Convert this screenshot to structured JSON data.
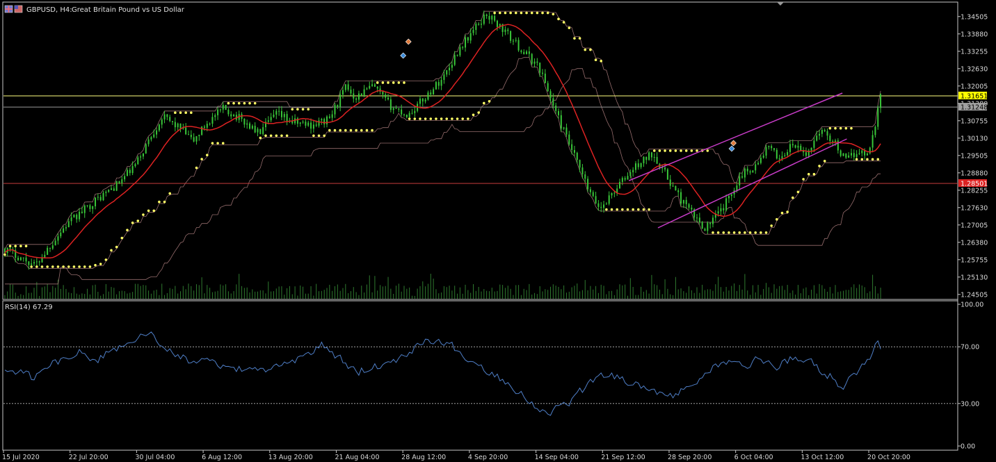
{
  "title": {
    "symbol_label": "GBPUSD, H4:",
    "description": "Great Britain Pound vs US Dollar"
  },
  "rsi": {
    "label": "RSI(14) 67.29",
    "levels": [
      70,
      30
    ],
    "ticks": [
      "100.00",
      "70.00",
      "30.00",
      "0.00"
    ]
  },
  "colors": {
    "background": "#000000",
    "candle": "#39c739",
    "parabolic_sar": "#ffff66",
    "moving_average": "#dd2222",
    "envelope": "#b08080",
    "channel": "#c83cc8",
    "volume": "#2f7a2f",
    "rsi_line": "#4f7fc8",
    "hline_current": "#ffff80",
    "hline_mid": "#9a9a9a",
    "hline_red": "#c83c3c",
    "current_price_box": "#ffff00",
    "mid_price_box": "#a0a0a0",
    "red_price_box": "#dd2222"
  },
  "chart_data": {
    "type": "line",
    "price_ticks": [
      "1.34505",
      "1.33880",
      "1.33255",
      "1.32630",
      "1.32005",
      "1.31380",
      "1.30755",
      "1.30130",
      "1.29505",
      "1.28880",
      "1.28255",
      "1.27630",
      "1.27005",
      "1.26380",
      "1.25755",
      "1.25130",
      "1.24505"
    ],
    "time_ticks": [
      "15 Jul 2020",
      "22 Jul 20:00",
      "30 Jul 04:00",
      "6 Aug 12:00",
      "13 Aug 20:00",
      "21 Aug 04:00",
      "28 Aug 12:00",
      "4 Sep 20:00",
      "14 Sep 04:00",
      "21 Sep 12:00",
      "28 Sep 20:00",
      "6 Oct 04:00",
      "13 Oct 12:00",
      "20 Oct 20:00"
    ],
    "ylim": [
      1.244,
      1.349
    ],
    "price_close_profile": [
      [
        0,
        1.2615
      ],
      [
        0.02,
        1.258
      ],
      [
        0.035,
        1.2555
      ],
      [
        0.05,
        1.262
      ],
      [
        0.07,
        1.27
      ],
      [
        0.1,
        1.278
      ],
      [
        0.13,
        1.285
      ],
      [
        0.15,
        1.292
      ],
      [
        0.165,
        1.301
      ],
      [
        0.18,
        1.309
      ],
      [
        0.2,
        1.305
      ],
      [
        0.215,
        1.3
      ],
      [
        0.23,
        1.3065
      ],
      [
        0.25,
        1.312
      ],
      [
        0.27,
        1.308
      ],
      [
        0.29,
        1.303
      ],
      [
        0.31,
        1.31
      ],
      [
        0.33,
        1.307
      ],
      [
        0.35,
        1.306
      ],
      [
        0.37,
        1.308
      ],
      [
        0.39,
        1.32
      ],
      [
        0.4,
        1.316
      ],
      [
        0.42,
        1.32
      ],
      [
        0.44,
        1.313
      ],
      [
        0.46,
        1.3095
      ],
      [
        0.48,
        1.316
      ],
      [
        0.5,
        1.323
      ],
      [
        0.52,
        1.334
      ],
      [
        0.55,
        1.346
      ],
      [
        0.57,
        1.34
      ],
      [
        0.59,
        1.333
      ],
      [
        0.61,
        1.327
      ],
      [
        0.63,
        1.31
      ],
      [
        0.65,
        1.295
      ],
      [
        0.67,
        1.28
      ],
      [
        0.68,
        1.276
      ],
      [
        0.7,
        1.284
      ],
      [
        0.72,
        1.291
      ],
      [
        0.74,
        1.296
      ],
      [
        0.755,
        1.288
      ],
      [
        0.77,
        1.28
      ],
      [
        0.79,
        1.272
      ],
      [
        0.8,
        1.269
      ],
      [
        0.82,
        1.276
      ],
      [
        0.84,
        1.288
      ],
      [
        0.86,
        1.292
      ],
      [
        0.87,
        1.298
      ],
      [
        0.885,
        1.294
      ],
      [
        0.9,
        1.299
      ],
      [
        0.915,
        1.295
      ],
      [
        0.93,
        1.304
      ],
      [
        0.945,
        1.301
      ],
      [
        0.96,
        1.293
      ],
      [
        0.975,
        1.297
      ],
      [
        0.985,
        1.295
      ],
      [
        0.995,
        1.308
      ],
      [
        1.0,
        1.3165
      ]
    ],
    "horizontal_lines": [
      {
        "price": 1.31651,
        "label": "1.31651"
      },
      {
        "price": 1.31248,
        "label": "1.31248"
      },
      {
        "price": 1.28501,
        "label": "1.28501"
      }
    ],
    "trend_channel": {
      "upper": [
        [
          0.712,
          1.286
        ],
        [
          0.955,
          1.3175
        ]
      ],
      "lower": [
        [
          0.745,
          1.269
        ],
        [
          0.96,
          1.301
        ]
      ]
    },
    "rsi_profile": [
      [
        0,
        55
      ],
      [
        0.03,
        48
      ],
      [
        0.06,
        60
      ],
      [
        0.08,
        68
      ],
      [
        0.1,
        60
      ],
      [
        0.13,
        70
      ],
      [
        0.15,
        75
      ],
      [
        0.165,
        80
      ],
      [
        0.18,
        70
      ],
      [
        0.2,
        62
      ],
      [
        0.23,
        58
      ],
      [
        0.26,
        55
      ],
      [
        0.28,
        52
      ],
      [
        0.31,
        56
      ],
      [
        0.34,
        62
      ],
      [
        0.36,
        72
      ],
      [
        0.38,
        62
      ],
      [
        0.4,
        52
      ],
      [
        0.42,
        56
      ],
      [
        0.45,
        62
      ],
      [
        0.47,
        72
      ],
      [
        0.49,
        76
      ],
      [
        0.51,
        70
      ],
      [
        0.53,
        60
      ],
      [
        0.56,
        50
      ],
      [
        0.58,
        42
      ],
      [
        0.6,
        30
      ],
      [
        0.62,
        24
      ],
      [
        0.64,
        30
      ],
      [
        0.66,
        40
      ],
      [
        0.68,
        52
      ],
      [
        0.7,
        48
      ],
      [
        0.72,
        44
      ],
      [
        0.74,
        40
      ],
      [
        0.76,
        34
      ],
      [
        0.78,
        42
      ],
      [
        0.8,
        52
      ],
      [
        0.82,
        60
      ],
      [
        0.84,
        56
      ],
      [
        0.86,
        62
      ],
      [
        0.88,
        56
      ],
      [
        0.9,
        62
      ],
      [
        0.92,
        58
      ],
      [
        0.94,
        50
      ],
      [
        0.955,
        42
      ],
      [
        0.97,
        50
      ],
      [
        0.985,
        62
      ],
      [
        0.995,
        74
      ],
      [
        1.0,
        67.29
      ]
    ]
  }
}
